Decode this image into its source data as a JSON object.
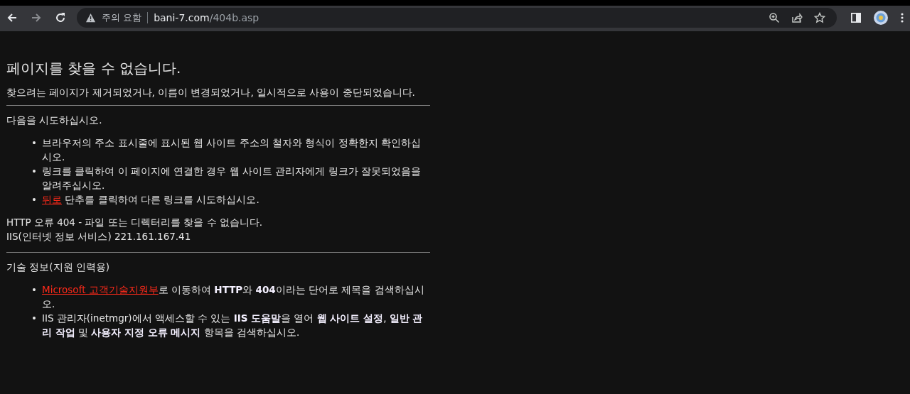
{
  "browser": {
    "back_enabled": true,
    "forward_enabled": false,
    "security_label": "주의 요함",
    "url_host": "bani-7.com",
    "url_path": "/404b.asp"
  },
  "page": {
    "title": "페이지를 찾을 수 없습니다.",
    "description": "찾으려는 페이지가 제거되었거나, 이름이 변경되었거나, 일시적으로 사용이 중단되었습니다.",
    "try_heading": "다음을 시도하십시오.",
    "try_items": [
      {
        "marker": "•",
        "text": "브라우저의 주소 표시줄에 표시된 웹 사이트 주소의 철자와 형식이 정확한지 확인하십시오."
      },
      {
        "marker": "•",
        "text": "링크를 클릭하여 이 페이지에 연결한 경우 웹 사이트 관리자에게 링크가 잘못되었음을 알려주십시오."
      },
      {
        "marker": "•",
        "link": "뒤로",
        "text": " 단추를 클릭하여 다른 링크를 시도하십시오."
      }
    ],
    "error_line": "HTTP 오류 404 - 파일 또는 디렉터리를 찾을 수 없습니다.",
    "server_line": "IIS(인터넷 정보 서비스) 221.161.167.41",
    "tech_heading": "기술 정보(지원 인력용)",
    "tech_items": [
      {
        "marker": "•",
        "link": "Microsoft 고객기술지원부",
        "text": "로 이동하여 **HTTP**와 **404**이라는 단어로 제목을 검색하십시오."
      },
      {
        "marker": "•",
        "text": "IIS 관리자(inetmgr)에서 액세스할 수 있는 **IIS 도움말**을 열어 **웹 사이트 설정**, **일반 관리 작업** 및 **사용자 지정 오류 메시지** 항목을 검색하십시오."
      }
    ]
  }
}
